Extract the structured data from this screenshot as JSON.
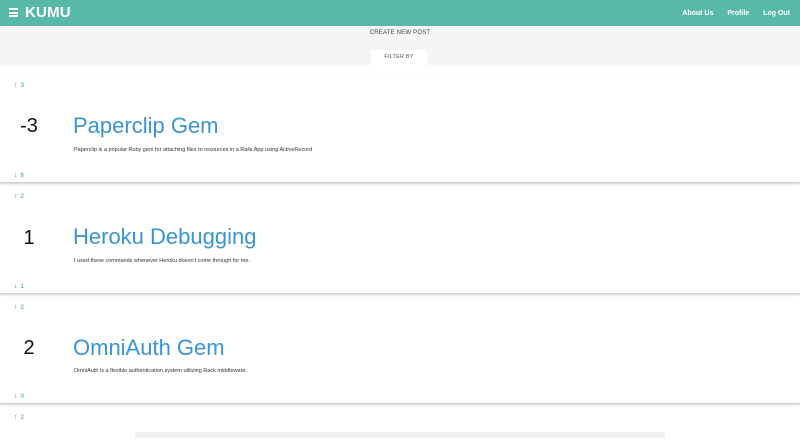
{
  "header": {
    "brand": "KUMU",
    "nav": {
      "about": "About Us",
      "profile": "Profile",
      "logout": "Log Out"
    },
    "accent_color": "#58b9a8"
  },
  "subbar": {
    "create_post": "CREATE NEW POST",
    "filter_by": "FILTER BY"
  },
  "posts": [
    {
      "upvotes": "3",
      "downvotes": "6",
      "score": "-3",
      "title": "Paperclip Gem",
      "description": "Paperclip is a popular Ruby gem for attaching files to resources in a Rails App using ActiveRecord"
    },
    {
      "upvotes": "2",
      "downvotes": "1",
      "score": "1",
      "title": "Heroku Debugging",
      "description": "I used these commands whenever Heroku doesn't come through for me."
    },
    {
      "upvotes": "2",
      "downvotes": "0",
      "score": "2",
      "title": "OmniAuth Gem",
      "description": "OmniAuth is a flexible authentication system utilizing Rack middleware."
    },
    {
      "upvotes": "2"
    }
  ],
  "icons": {
    "upvote": "arrow-up-icon",
    "downvote": "arrow-down-icon",
    "menu": "hamburger-menu-icon"
  },
  "colors": {
    "link": "#3a95d2",
    "vote": "#2f8fc8"
  }
}
